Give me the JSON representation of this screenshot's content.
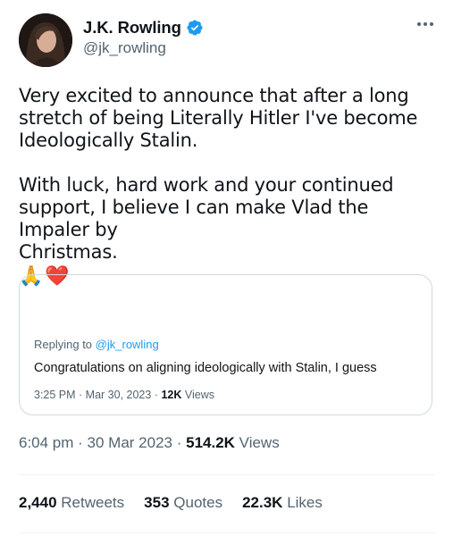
{
  "author": {
    "display_name": "J.K. Rowling",
    "handle": "@jk_rowling",
    "verified": true,
    "verified_color": "#1d9bf0"
  },
  "more_icon": "more-horizontal-icon",
  "tweet": {
    "paragraph_1": "Very excited to announce that after a long\nstretch of being Literally Hitler I've become\nIdeologically Stalin.",
    "paragraph_2": "With luck, hard work and your continued\nsupport, I believe I can make Vlad the Impaler by\nChristmas.",
    "emoji_1": "🙏",
    "emoji_2": "❤️"
  },
  "quoted": {
    "replying_prefix": "Replying to",
    "replying_to": "@jk_rowling",
    "text": "Congratulations on aligning ideologically with Stalin, I guess",
    "time": "3:25 PM",
    "date": "Mar 30, 2023",
    "views_count": "12K",
    "views_label": "Views"
  },
  "meta": {
    "time": "6:04 pm",
    "date": "30 Mar 2023",
    "views_count": "514.2K",
    "views_label": "Views"
  },
  "stats": {
    "retweets_count": "2,440",
    "retweets_label": "Retweets",
    "quotes_count": "353",
    "quotes_label": "Quotes",
    "likes_count": "22.3K",
    "likes_label": "Likes"
  },
  "colors": {
    "text_primary": "#0f1419",
    "text_secondary": "#536471",
    "link": "#1d9bf0",
    "border": "#cfd9de"
  }
}
